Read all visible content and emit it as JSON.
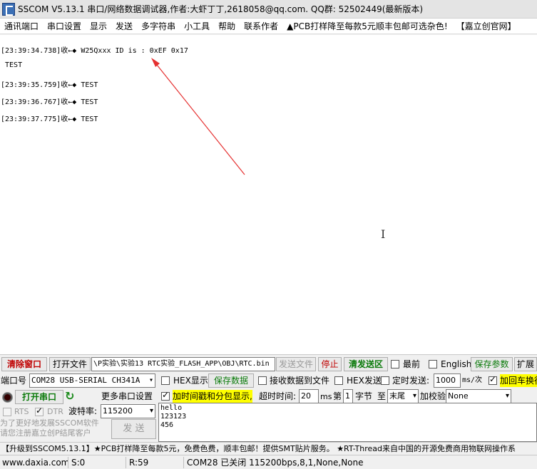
{
  "window": {
    "title": "SSCOM V5.13.1 串口/网络数据调试器,作者:大虾丁丁,2618058@qq.com. QQ群: 52502449(最新版本)"
  },
  "menu": [
    "通讯端口",
    "串口设置",
    "显示",
    "发送",
    "多字符串",
    "小工具",
    "帮助",
    "联系作者",
    "▲PCB打样降至每款5元顺丰包邮可选杂色!",
    "【嘉立创官网】"
  ],
  "receive_log": [
    "[23:39:34.738]收←◆ W25Qxxx ID is : 0xEF 0x17",
    " TEST",
    "[23:39:35.759]收←◆ TEST",
    "[23:39:36.767]收←◆ TEST",
    "[23:39:37.775]收←◆ TEST"
  ],
  "toolbar": {
    "clear_window": "清除窗口",
    "open_file": "打开文件",
    "file_path": "\\P实验\\实验13 RTC实验_FLASH_APP\\OBJ\\RTC.bin",
    "send_file": "发送文件",
    "stop": "停止",
    "clear_send_area": "清发送区",
    "front_most": "最前",
    "english": "English",
    "save_params": "保存参数",
    "expand": "扩展"
  },
  "port": {
    "port_label": "端口号",
    "port_value": "COM28 USB-SERIAL CH341A",
    "hex_display": "HEX显示",
    "save_data": "保存数据",
    "receive_to_file": "接收数据到文件",
    "hex_send": "HEX发送",
    "timed_send": "定时发送:",
    "interval_value": "1000",
    "interval_unit": "ms/次",
    "add_crlf": "加回车换行",
    "open_port": "打开串口",
    "more_settings": "更多串口设置",
    "timestamp_split": "加时间戳和分包显示,",
    "timeout_label": "超时时间:",
    "timeout_value": "20",
    "timeout_unit": "ms",
    "nth_label": "第",
    "nth_value": "1",
    "byte_label": "字节",
    "to_label": "至",
    "end_value": "末尾",
    "checksum_label": "加校验",
    "checksum_value": "None",
    "rts": "RTS",
    "dtr": "DTR",
    "baud_label": "波特率:",
    "baud_value": "115200",
    "send_button": "发  送",
    "promo_line1": "为了更好地发展SSCOM软件",
    "promo_line2": "请您注册嘉立创P结尾客户"
  },
  "send_text": "hello\n123123\n456",
  "promo_bar": "【升级到SSCOM5.13.1】★PCB打样降至每款5元，免费色费，顺丰包邮！提供SMT贴片服务。 ★RT-Thread来自中国的开源免费商用物联网操作系",
  "status": {
    "website": "www.daxia.com",
    "sent": "S:0",
    "received": "R:59",
    "port_state": "COM28 已关闭  115200bps,8,1,None,None"
  }
}
